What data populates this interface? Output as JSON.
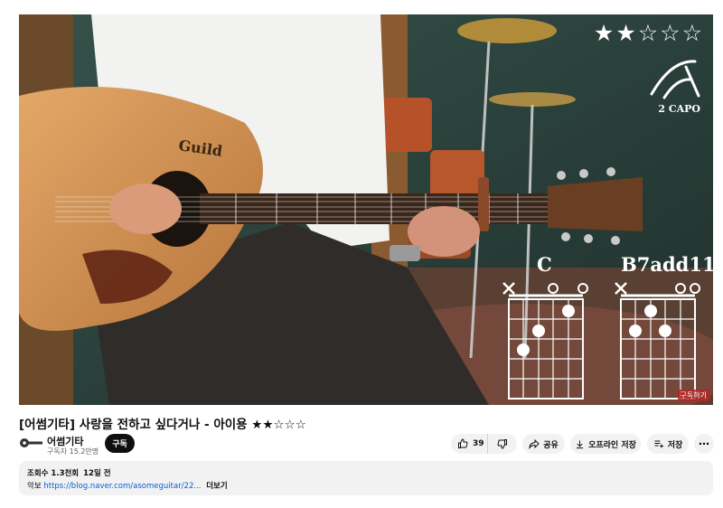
{
  "video": {
    "overlay_rating": [
      "★",
      "★",
      "☆",
      "☆",
      "☆"
    ],
    "capo_label": "2 CAPO",
    "chord_1": "C",
    "chord_2": "B7add11",
    "corner_badge": "구독하기",
    "guitar_brand": "Guild"
  },
  "title": "[어썸기타] 사랑을 전하고 싶다거나 - 아이용 ★★☆☆☆",
  "channel": {
    "name": "어썸기타",
    "subscribers": "구독자 15.2만명",
    "subscribe_label": "구독"
  },
  "actions": {
    "like_count": "39",
    "share_label": "공유",
    "offline_label": "오프라인 저장",
    "save_label": "저장",
    "more_label": "⋯"
  },
  "description": {
    "views": "조회수 1.3천회",
    "date": "12일 전",
    "prefix": "악보",
    "link": "https://blog.naver.com/asomeguitar/22...",
    "more_label": "더보기"
  },
  "icons": {
    "like": "thumb-up-icon",
    "dislike": "thumb-down-icon",
    "share": "share-arrow-icon",
    "download": "download-icon",
    "save": "playlist-add-icon",
    "capo": "capo-icon"
  }
}
